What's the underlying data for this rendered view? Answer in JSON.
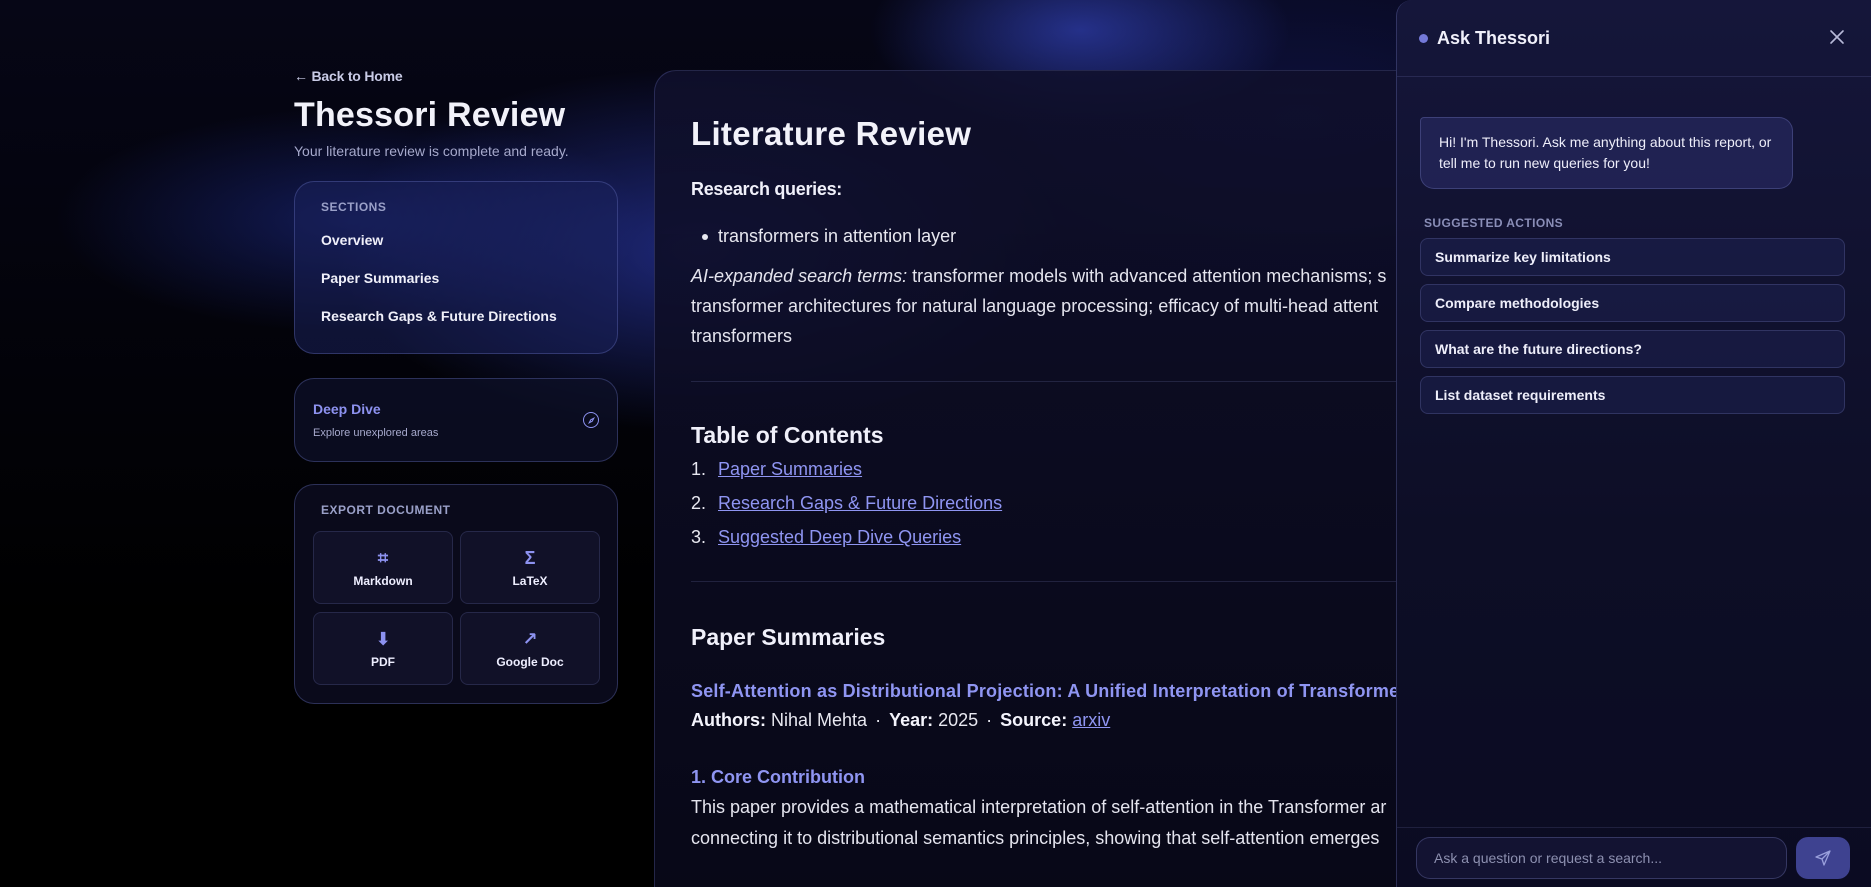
{
  "nav": {
    "back_label": "← Back to Home"
  },
  "header": {
    "title": "Thessori Review",
    "subtitle": "Your literature review is complete and ready."
  },
  "sections": {
    "label": "SECTIONS",
    "items": [
      {
        "label": "Overview"
      },
      {
        "label": "Paper Summaries"
      },
      {
        "label": "Research Gaps & Future Directions"
      }
    ]
  },
  "deep_dive": {
    "title": "Deep Dive",
    "subtitle": "Explore unexplored areas",
    "icon": "compass-icon"
  },
  "export": {
    "label": "EXPORT DOCUMENT",
    "items": [
      {
        "label": "Markdown",
        "icon": "⌗",
        "icon_name": "markdown-icon"
      },
      {
        "label": "LaTeX",
        "icon": "Σ",
        "icon_name": "sigma-icon"
      },
      {
        "label": "PDF",
        "icon": "⬇",
        "icon_name": "download-icon"
      },
      {
        "label": "Google Doc",
        "icon": "↗",
        "icon_name": "external-link-icon"
      }
    ]
  },
  "document": {
    "title": "Literature Review",
    "research_queries_label": "Research queries:",
    "queries": [
      "transformers in attention layer"
    ],
    "expanded_label": "AI-expanded search terms:",
    "expanded_line1": " transformer models with advanced attention mechanisms; s",
    "expanded_line2": "transformer architectures for natural language processing; efficacy of multi-head attent",
    "expanded_line3": "transformers",
    "toc_title": "Table of Contents",
    "toc": [
      {
        "num": "1.",
        "label": "Paper Summaries"
      },
      {
        "num": "2.",
        "label": "Research Gaps & Future Directions"
      },
      {
        "num": "3.",
        "label": "Suggested Deep Dive Queries"
      }
    ],
    "paper_summaries_title": "Paper Summaries",
    "paper": {
      "title": "Self-Attention as Distributional Projection: A Unified Interpretation of Transforme",
      "authors_label": "Authors:",
      "authors": "Nihal Mehta",
      "year_label": "Year:",
      "year": "2025",
      "source_label": "Source:",
      "source": "arxiv",
      "separator": "·",
      "section_heading": "1. Core Contribution",
      "body_line1": "This paper provides a mathematical interpretation of self-attention in the Transformer ar",
      "body_line2": "connecting it to distributional semantics principles, showing that self-attention emerges"
    }
  },
  "chat": {
    "title": "Ask Thessori",
    "greeting": "Hi! I'm Thessori. Ask me anything about this report, or tell me to run new queries for you!",
    "suggested_label": "SUGGESTED ACTIONS",
    "suggestions": [
      {
        "label": "Summarize key limitations"
      },
      {
        "label": "Compare methodologies"
      },
      {
        "label": "What are the future directions?"
      },
      {
        "label": "List dataset requirements"
      }
    ],
    "input_placeholder": "Ask a question or request a search...",
    "input_value": ""
  },
  "colors": {
    "accent": "#8f95f2",
    "background": "#000000",
    "panel": "#15163a"
  }
}
